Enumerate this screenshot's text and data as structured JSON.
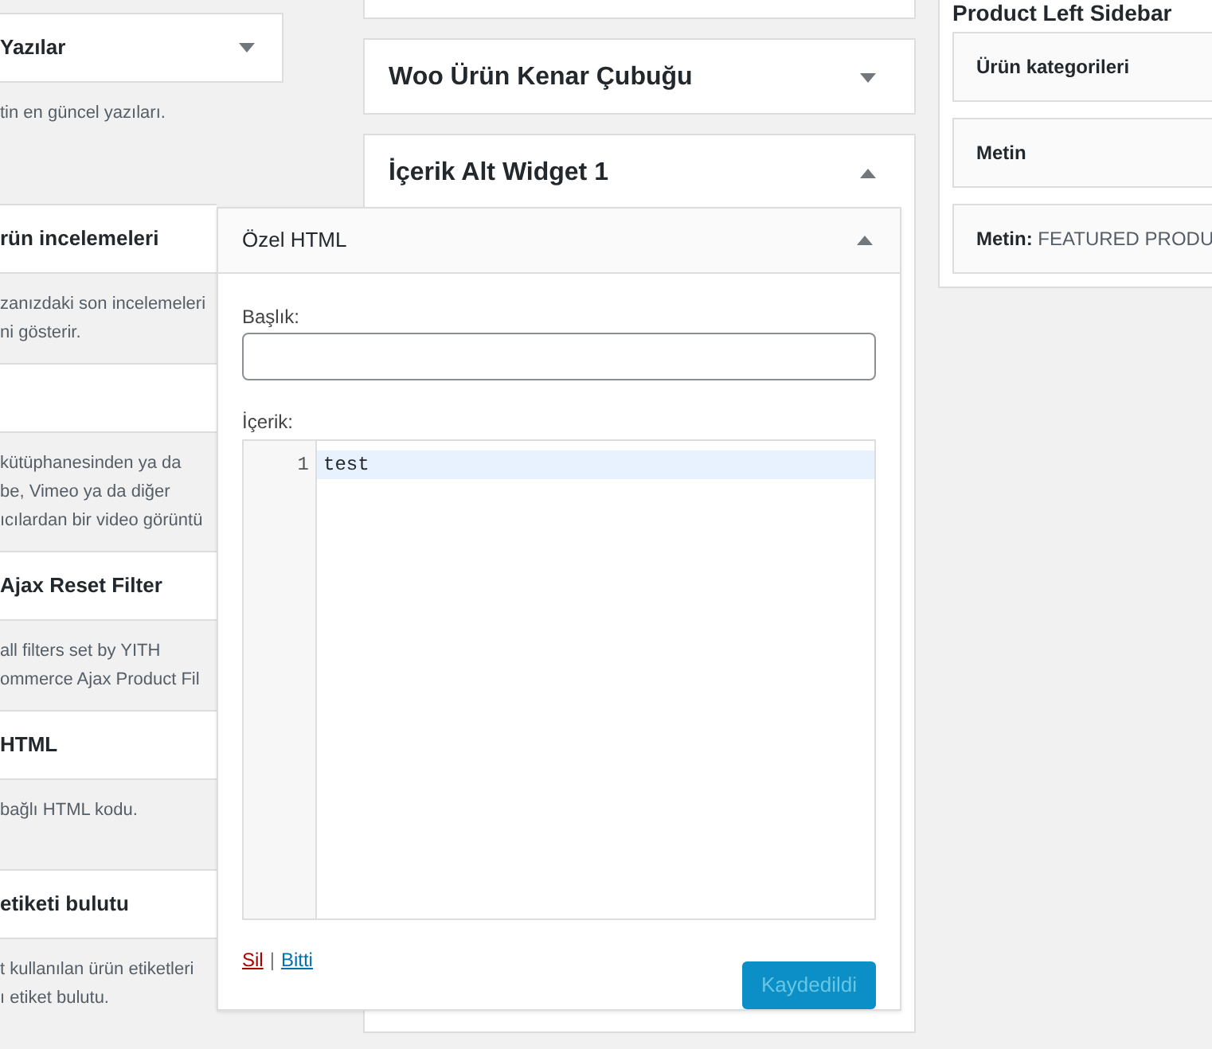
{
  "available_widgets": [
    {
      "title": "Yazılar",
      "expanded": false,
      "description": [
        "tin en güncel yazıları."
      ]
    },
    {
      "title": "rün incelemeleri",
      "description": [
        "zanızdaki son incelemeleri",
        "ni gösterir."
      ]
    },
    {
      "description": [
        "kütüphanesinden ya da",
        "be, Vimeo ya da diğer",
        "ıcılardan bir video görüntü"
      ]
    },
    {
      "title": "Ajax Reset Filter",
      "description": [
        "all filters set by YITH",
        "ommerce Ajax Product Fil"
      ]
    },
    {
      "title": "HTML",
      "description": [
        "bağlı HTML kodu."
      ]
    },
    {
      "title": "etiketi bulutu",
      "description": [
        "t kullanılan ürün etiketleri",
        "ı etiket bulutu."
      ]
    }
  ],
  "sidebars": [
    {
      "title": "Woo Ürün Kenar Çubuğu",
      "expanded": false
    },
    {
      "title": "İçerik Alt Widget 1",
      "expanded": true
    }
  ],
  "right_sidebar": {
    "title": "Product Left Sidebar",
    "widgets": [
      {
        "name": "Ürün kategorileri"
      },
      {
        "name": "Metin"
      },
      {
        "name": "Metin:",
        "subtitle": "FEATURED PRODU"
      }
    ]
  },
  "widget_form": {
    "title": "Özel HTML",
    "expanded": true,
    "title_label": "Başlık:",
    "content_label": "İçerik:",
    "code_lines": [
      {
        "number": "1",
        "text": "test",
        "selected": true
      }
    ],
    "delete_link": "Sil",
    "separator": "|",
    "done_link": "Bitti",
    "save_button": {
      "label": "Kaydedildi",
      "disabled": true
    }
  }
}
